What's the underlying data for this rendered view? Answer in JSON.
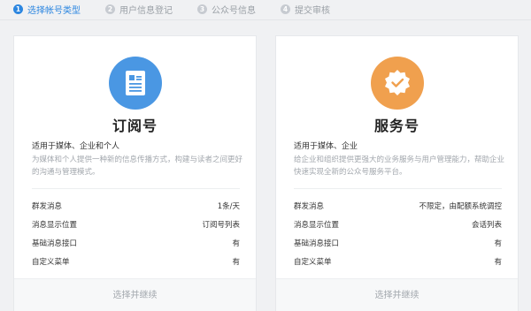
{
  "steps": [
    {
      "num": "1",
      "label": "选择帐号类型"
    },
    {
      "num": "2",
      "label": "用户信息登记"
    },
    {
      "num": "3",
      "label": "公众号信息"
    },
    {
      "num": "4",
      "label": "提交审核"
    }
  ],
  "cards": [
    {
      "title": "订阅号",
      "suitable": "适用于媒体、企业和个人",
      "description": "为媒体和个人提供一种新的信息传播方式，构建与读者之间更好的沟通与管理模式。",
      "features": [
        {
          "label": "群发消息",
          "value": "1条/天"
        },
        {
          "label": "消息显示位置",
          "value": "订阅号列表"
        },
        {
          "label": "基础消息接口",
          "value": "有"
        },
        {
          "label": "自定义菜单",
          "value": "有"
        }
      ],
      "button": "选择并继续",
      "icon": "document-icon",
      "color": "#4a97e3"
    },
    {
      "title": "服务号",
      "suitable": "适用于媒体、企业",
      "description": "给企业和组织提供更强大的业务服务与用户管理能力，帮助企业快速实现全新的公众号服务平台。",
      "features": [
        {
          "label": "群发消息",
          "value": "不限定，由配额系统调控"
        },
        {
          "label": "消息显示位置",
          "value": "会话列表"
        },
        {
          "label": "基础消息接口",
          "value": "有"
        },
        {
          "label": "自定义菜单",
          "value": "有"
        }
      ],
      "button": "选择并继续",
      "icon": "verified-check-icon",
      "color": "#f0a04e"
    }
  ]
}
